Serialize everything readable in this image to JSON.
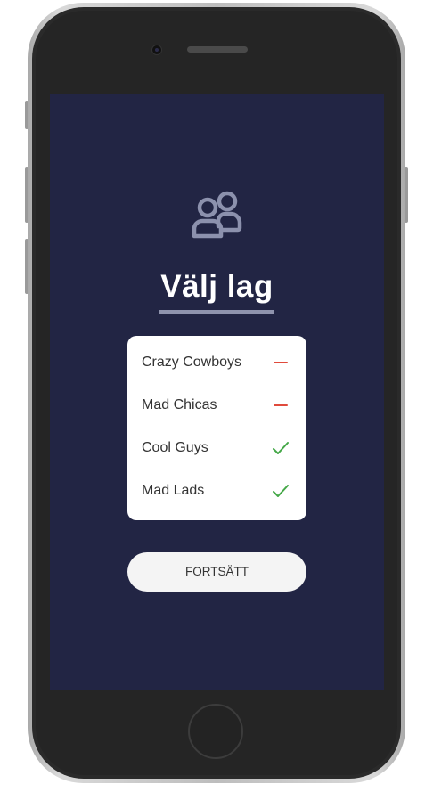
{
  "screen": {
    "title": "Välj lag",
    "background": "#222544",
    "teams": [
      {
        "name": "Crazy Cowboys",
        "status": "dash",
        "status_icon": "minus-icon",
        "color": "#e04a3c"
      },
      {
        "name": "Mad Chicas",
        "status": "dash",
        "status_icon": "minus-icon",
        "color": "#e04a3c"
      },
      {
        "name": "Cool Guys",
        "status": "check",
        "status_icon": "check-icon",
        "color": "#45a848"
      },
      {
        "name": "Mad Lads",
        "status": "check",
        "status_icon": "check-icon",
        "color": "#45a848"
      }
    ],
    "continue_label": "FORTSÄTT"
  }
}
